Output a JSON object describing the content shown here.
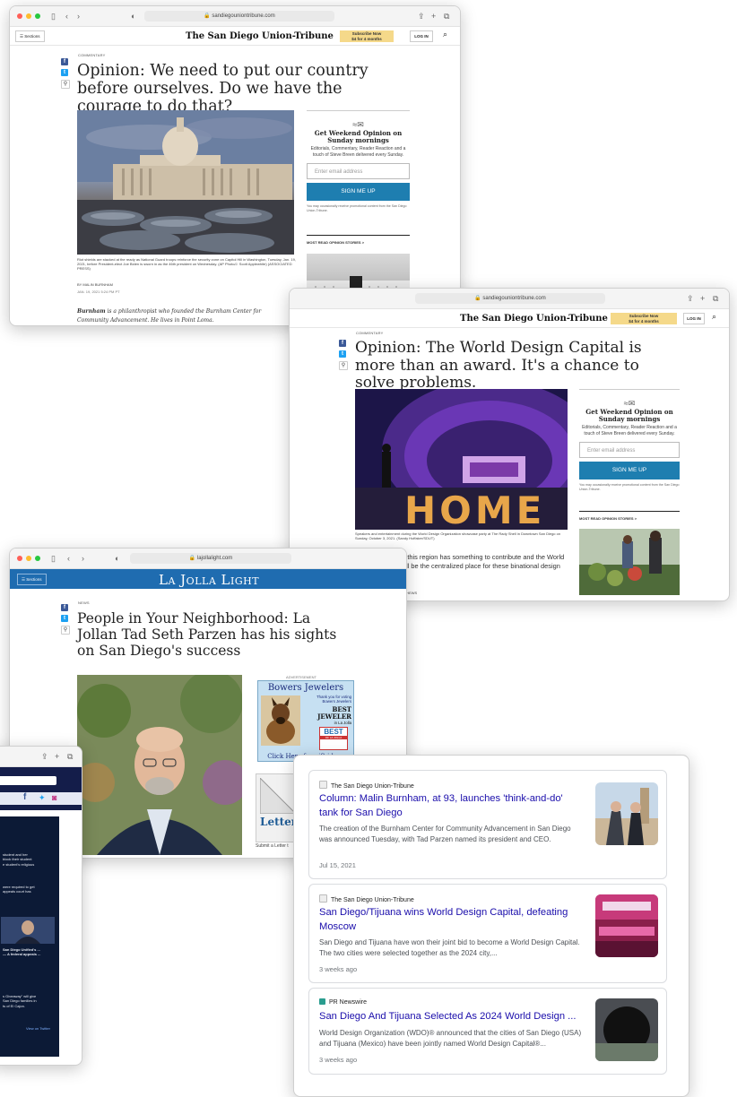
{
  "ut_window_1": {
    "url": "sandiegouniontribune.com",
    "logo": "The San Diego Union-Tribune",
    "sections": "Sections",
    "subscribe": "Subscribe Now\n$4 for 4 months",
    "login": "LOG IN",
    "kicker": "COMMENTARY",
    "headline": "Opinion: We need to put our country before ourselves. Do we have the courage to do that?",
    "caption": "Riot shields are stacked at the ready as National Guard troops reinforce the security zone on Capitol Hill in Washington, Tuesday, Jan. 19, 2021, before President-elect Joe Biden is sworn in as the 46th president on Wednesday. (AP Photo/J. Scott Applewhite) (ASSOCIATED PRESS)",
    "byline": "BY MALIN BURNHAM",
    "date": "JAN. 19, 2021 5:24 PM PT",
    "body_lead": "Burnham",
    "body_text": " is a philanthropist who founded the Burnham Center for Community Advancement. He lives in Point Loma.",
    "newsletter": {
      "title": "Get Weekend Opinion on Sunday mornings",
      "desc": "Editorials, Commentary, Reader Reaction and a touch of Steve Breen delivered every Sunday.",
      "placeholder": "Enter email address",
      "button": "SIGN ME UP",
      "fine": "You may occasionally receive promotional content from the San Diego Union-Tribune."
    },
    "most_read": "MOST READ OPINION STORIES  >"
  },
  "ut_window_2": {
    "url": "sandiegouniontribune.com",
    "logo": "The San Diego Union-Tribune",
    "subscribe": "Subscribe Now\n$4 for 4 months",
    "login": "LOG IN",
    "kicker": "COMMENTARY",
    "headline": "Opinion: The World Design Capital is more than an award. It's a chance to solve problems.",
    "caption": "Speakers and entertainment during the World Design Organization showcase party at The Rady Shell in Downtown San Diego on Sunday, October 3, 2021. (Sandy Huffaker/SDUT)",
    "body": "Every member of this region has something to contribute and the World Design Capital will be the centralized place for these binational design contributions",
    "byline": "BY TAD PARZEN, EDDIE MATTHEWS",
    "sign_text": "HOME",
    "newsletter": {
      "title": "Get Weekend Opinion on Sunday mornings",
      "desc": "Editorials, Commentary, Reader Reaction and a touch of Steve Breen delivered every Sunday.",
      "placeholder": "Enter email address",
      "button": "SIGN ME UP",
      "fine": "You may occasionally receive promotional content from the San Diego Union-Tribune."
    },
    "most_read": "MOST READ OPINION STORIES  >"
  },
  "ljl_window": {
    "url": "lajollalight.com",
    "sections": "Sections",
    "logo": "La Jolla Light",
    "kicker": "NEWS",
    "headline": "People in Your Neighborhood: La Jollan Tad Seth Parzen has his sights on San Diego's success",
    "ad_label": "ADVERTISEMENT",
    "ad": {
      "title": "Bowers Jewelers",
      "line1": "Thank you for voting Bowers Jewelers",
      "best": "BEST",
      "jeweler": "JEWELER",
      "in": "in La Jolla",
      "badge": "BEST",
      "badge_sub": "OF LA JOLLA",
      "cta": "Click Here for gift ideas"
    },
    "letter_ad": "Letter",
    "letter_caption": "Submit a Letter t"
  },
  "twitter_window": {
    "tweets": [
      "student and her\nblock their student\ne student's religious",
      "were required to get\nappeals court has",
      "San Diego Unified's ...\n— A federal appeals ...",
      "s Giveaway\" will give\nSan Diego families in\nts of El Cajon."
    ],
    "view_on_twitter": "View on Twitter"
  },
  "results": [
    {
      "source": "The San Diego Union-Tribune",
      "title": "Column: Malin Burnham, at 93, launches 'think-and-do' tank for San Diego",
      "snippet": "The creation of the Burnham Center for Community Advancement in San Diego was announced Tuesday, with Tad Parzen named its president and CEO.",
      "date": "Jul 15, 2021"
    },
    {
      "source": "The San Diego Union-Tribune",
      "title": "San Diego/Tijuana wins World Design Capital, defeating Moscow",
      "snippet": "San Diego and Tijuana have won their joint bid to become a World Design Capital. The two cities were selected together as the 2024 city,...",
      "date": "3 weeks ago"
    },
    {
      "source": "PR Newswire",
      "title": "San Diego And Tijuana Selected As 2024 World Design ...",
      "snippet": "World Design Organization (WDO)® announced that the cities of San Diego (USA) and Tijuana (Mexico) have been jointly named World Design Capital®...",
      "date": "3 weeks ago"
    }
  ],
  "colors": {
    "ljl_blue": "#1f6cb0",
    "signup_blue": "#1e7eb0",
    "subscribe_yellow": "#f5d98a",
    "result_title": "#1a0dab"
  }
}
